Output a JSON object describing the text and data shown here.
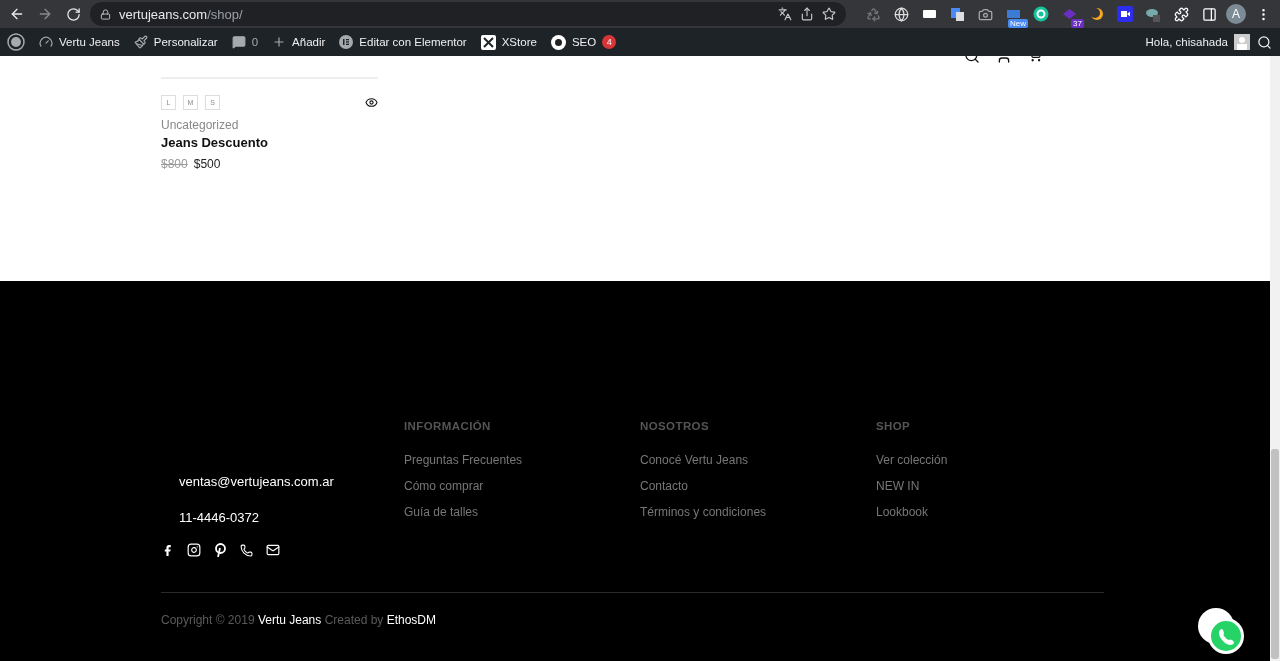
{
  "browser": {
    "url_host": "vertujeans.com",
    "url_path": "/shop/",
    "extension_badges": [
      {
        "kind": "new",
        "text": "New"
      },
      {
        "kind": "count",
        "text": "37"
      }
    ],
    "profile_initial": "A"
  },
  "admin_bar": {
    "items": [
      {
        "kind": "site",
        "text": "Vertu Jeans"
      },
      {
        "kind": "customize",
        "text": "Personalizar"
      },
      {
        "kind": "comments",
        "text": "0"
      },
      {
        "kind": "add",
        "text": "Añadir"
      },
      {
        "kind": "elementor",
        "text": "Editar con Elementor"
      },
      {
        "kind": "xstore",
        "text": "XStore"
      },
      {
        "kind": "seo",
        "text": "SEO",
        "badge": "4"
      }
    ],
    "greeting": "Hola, chisahada"
  },
  "product": {
    "sizes": [
      "L",
      "M",
      "S"
    ],
    "category": "Uncategorized",
    "name": "Jeans Descuento",
    "old_price": "$800",
    "price": "$500"
  },
  "footer": {
    "email": "ventas@vertujeans.com.ar",
    "phone": "11-4446-0372",
    "columns": [
      {
        "heading": "INFORMACIÓN",
        "links": [
          "Preguntas Frecuentes",
          "Cómo comprar",
          "Guía de talles"
        ]
      },
      {
        "heading": "NOSOTROS",
        "links": [
          "Conocé Vertu Jeans",
          "Contacto",
          "Términos y condiciones"
        ]
      },
      {
        "heading": "SHOP",
        "links": [
          "Ver colección",
          "NEW IN",
          "Lookbook"
        ]
      }
    ],
    "copyright": [
      {
        "kind": "text",
        "text": "Copyright © 2019"
      },
      {
        "kind": "link",
        "text": "Vertu Jeans"
      },
      {
        "kind": "text",
        "text": "Created by"
      },
      {
        "kind": "link",
        "text": "EthosDM"
      }
    ]
  }
}
